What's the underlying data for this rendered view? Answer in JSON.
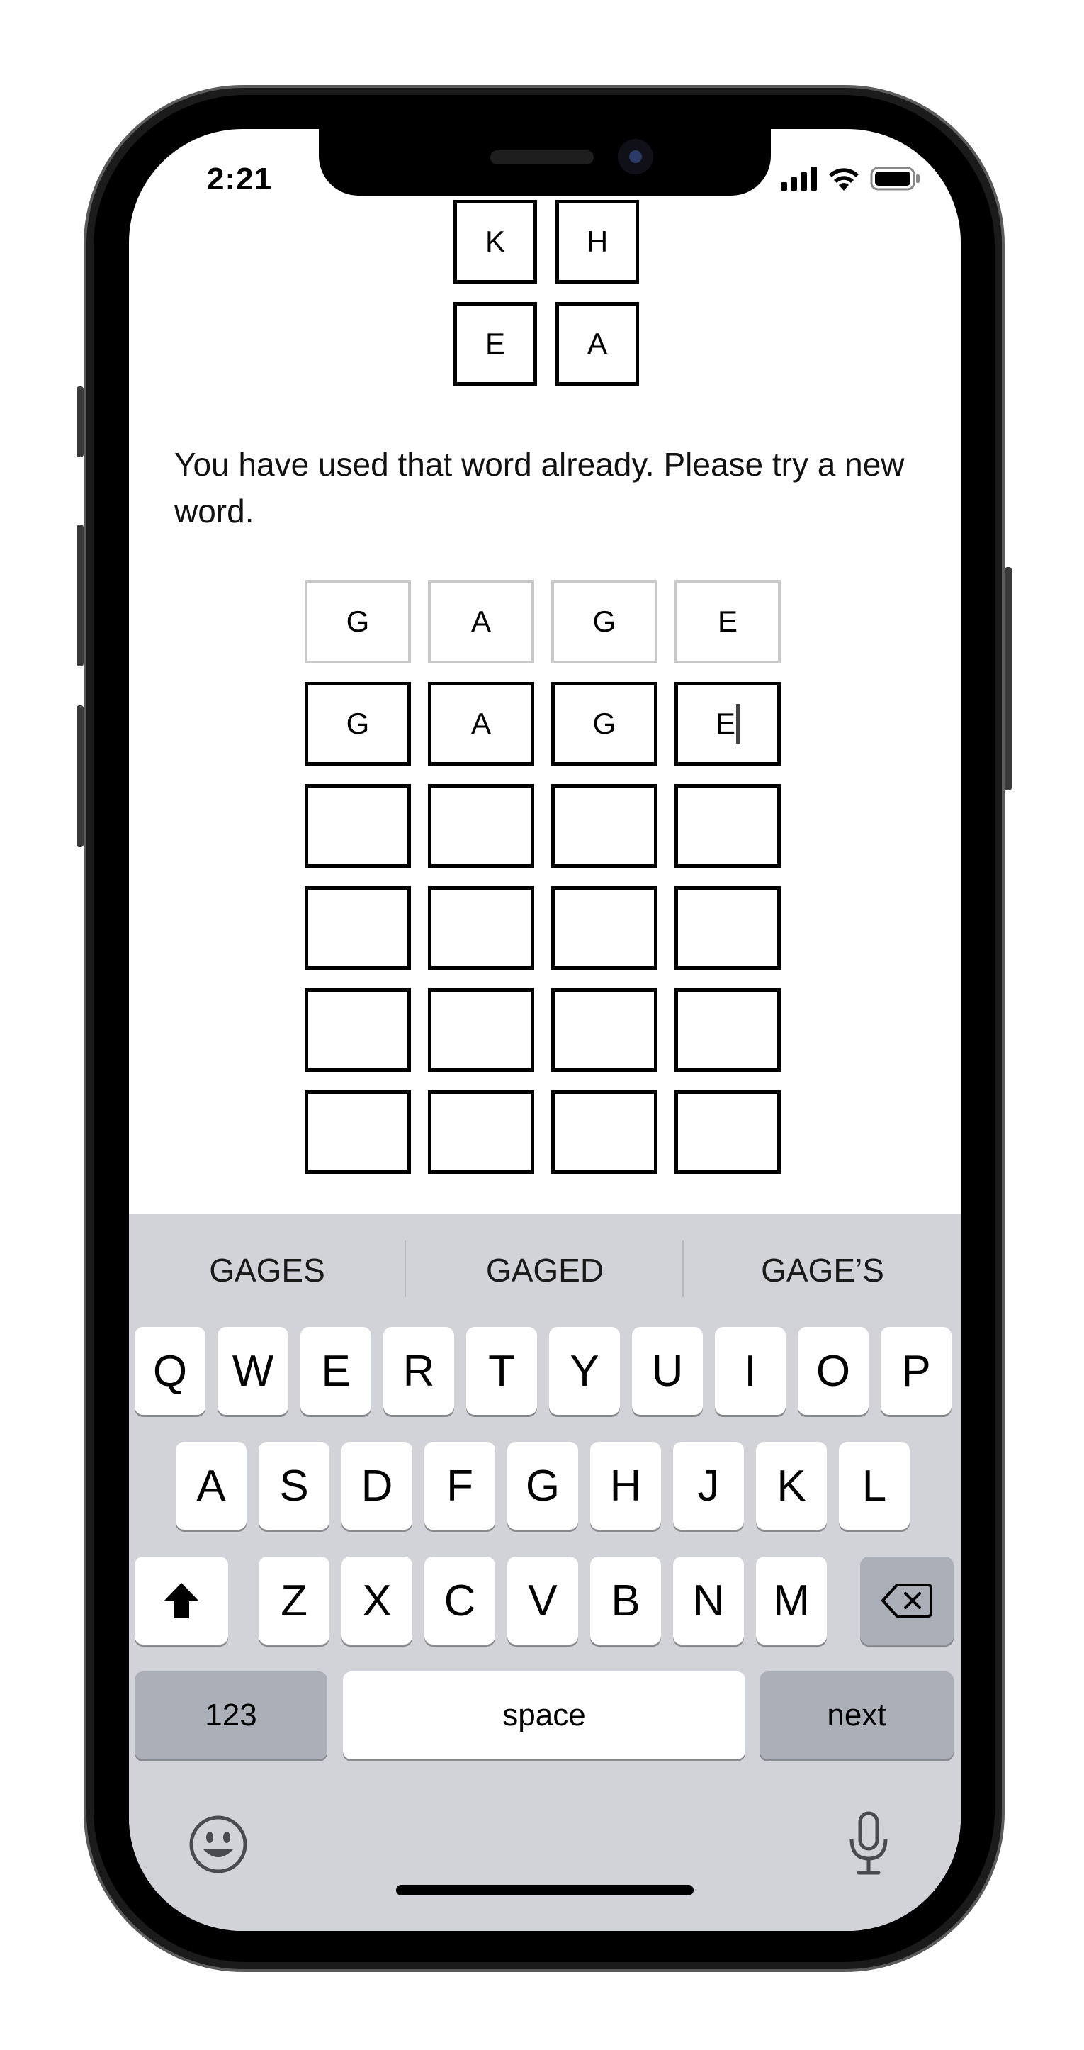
{
  "status_bar": {
    "time": "2:21",
    "icons": [
      "cellular-signal-icon",
      "wifi-icon",
      "battery-icon"
    ]
  },
  "letter_tiles": {
    "row1": [
      "K",
      "H"
    ],
    "row2": [
      "E",
      "A"
    ]
  },
  "message": "You have used that word already. Please try a new word.",
  "grid": {
    "previous_guess": [
      "G",
      "A",
      "G",
      "E"
    ],
    "current_guess": [
      "G",
      "A",
      "G",
      "E"
    ],
    "empty_rows": 4
  },
  "keyboard": {
    "suggestions": [
      "GAGES",
      "GAGED",
      "GAGE’S"
    ],
    "row1": [
      "Q",
      "W",
      "E",
      "R",
      "T",
      "Y",
      "U",
      "I",
      "O",
      "P"
    ],
    "row2": [
      "A",
      "S",
      "D",
      "F",
      "G",
      "H",
      "J",
      "K",
      "L"
    ],
    "row3": [
      "Z",
      "X",
      "C",
      "V",
      "B",
      "N",
      "M"
    ],
    "numbers_label": "123",
    "space_label": "space",
    "return_label": "next",
    "icons": [
      "shift-icon",
      "delete-icon",
      "emoji-icon",
      "microphone-icon"
    ]
  },
  "colors": {
    "keyboard_bg": "#d2d3d8",
    "dark_key": "#abafb8",
    "ghost_border": "#c8c8c8"
  }
}
